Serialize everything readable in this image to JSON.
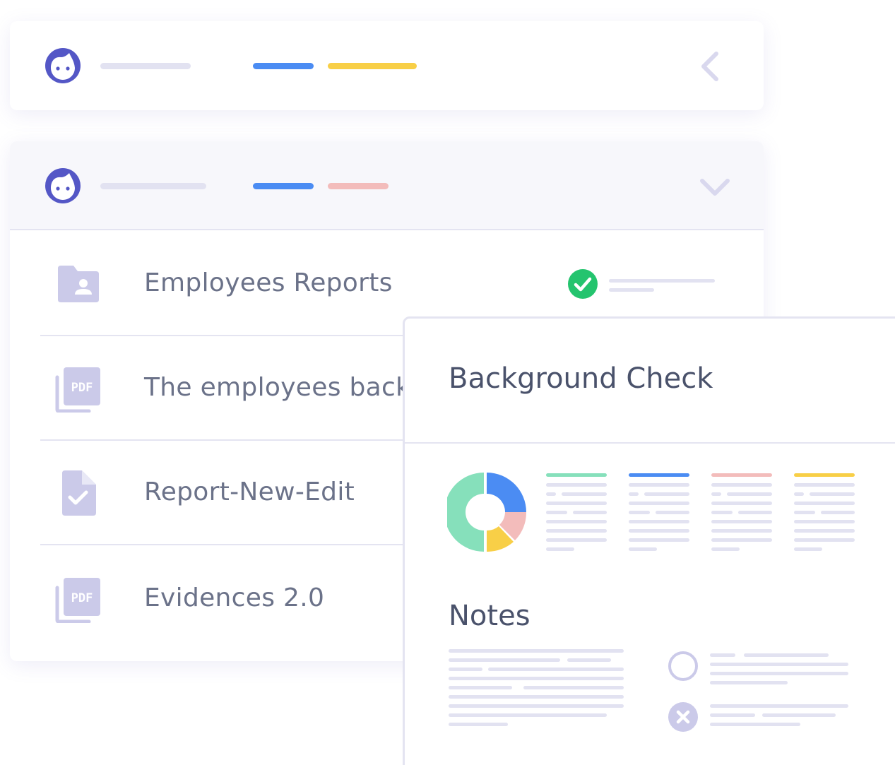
{
  "top_card": {
    "avatar_icon": "face-icon",
    "collapse_icon": "chevron-left-icon"
  },
  "main_card": {
    "avatar_icon": "face-icon",
    "expand_icon": "chevron-down-icon",
    "files": [
      {
        "label": "Employees Reports",
        "icon": "folder-user-icon",
        "status_icon": "check-circle-icon"
      },
      {
        "label": "The employees background",
        "icon": "pdf-icon"
      },
      {
        "label": "Report-New-Edit",
        "icon": "document-check-icon"
      },
      {
        "label": "Evidences 2.0",
        "icon": "pdf-icon"
      }
    ]
  },
  "pdf_badge": "PDF",
  "panel": {
    "title": "Background Check",
    "notes_title": "Notes",
    "chart_icon": "donut-chart-icon",
    "note_icons": [
      "circle-outline-icon",
      "close-circle-icon"
    ]
  },
  "colors": {
    "accent": "#5457c6",
    "blue": "#4b8cf3",
    "yellow": "#f8cf47",
    "pink": "#f3bcbb",
    "green": "#86e0bb",
    "success": "#24c46e",
    "placeholder": "#e2e2f1",
    "icon": "#cbcae9"
  }
}
